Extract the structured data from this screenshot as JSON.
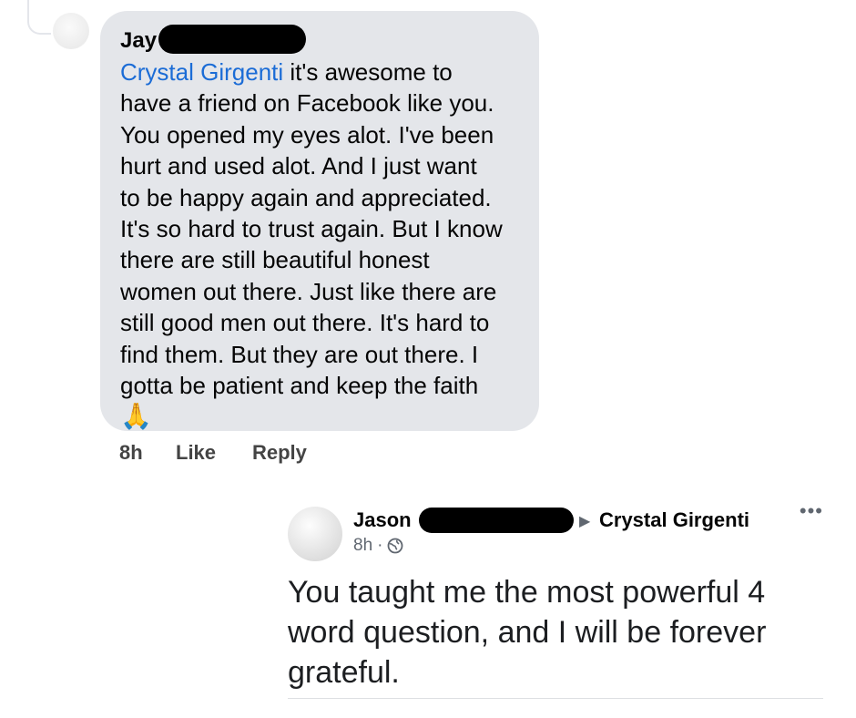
{
  "comment": {
    "author_visible": "Jay",
    "mention": "Crystal Girgenti",
    "text": " it's awesome to\nhave a friend on Facebook like you.\nYou opened my eyes alot. I've been\nhurt and used alot. And I just want\nto be happy again and appreciated.\nIt's so hard to trust again. But I know\nthere are still beautiful honest\nwomen out there. Just like there are\nstill good men out there. It's hard to\nfind them. But they are out there. I\ngotta be patient and keep the faith",
    "emoji": "🙏",
    "time": "8h",
    "like_label": "Like",
    "reply_label": "Reply"
  },
  "post": {
    "author_visible": "Jason",
    "arrow": "▶",
    "target": "Crystal Girgenti",
    "time": "8h",
    "separator": "·",
    "more": "•••",
    "text": "You taught me the most powerful 4 word question, and I will be forever grateful."
  },
  "icons": {
    "privacy": "globe-icon",
    "options": "more-options-icon"
  },
  "colors": {
    "bubble": "#e4e6ea",
    "mention": "#1b6cd6",
    "meta": "#606770"
  }
}
